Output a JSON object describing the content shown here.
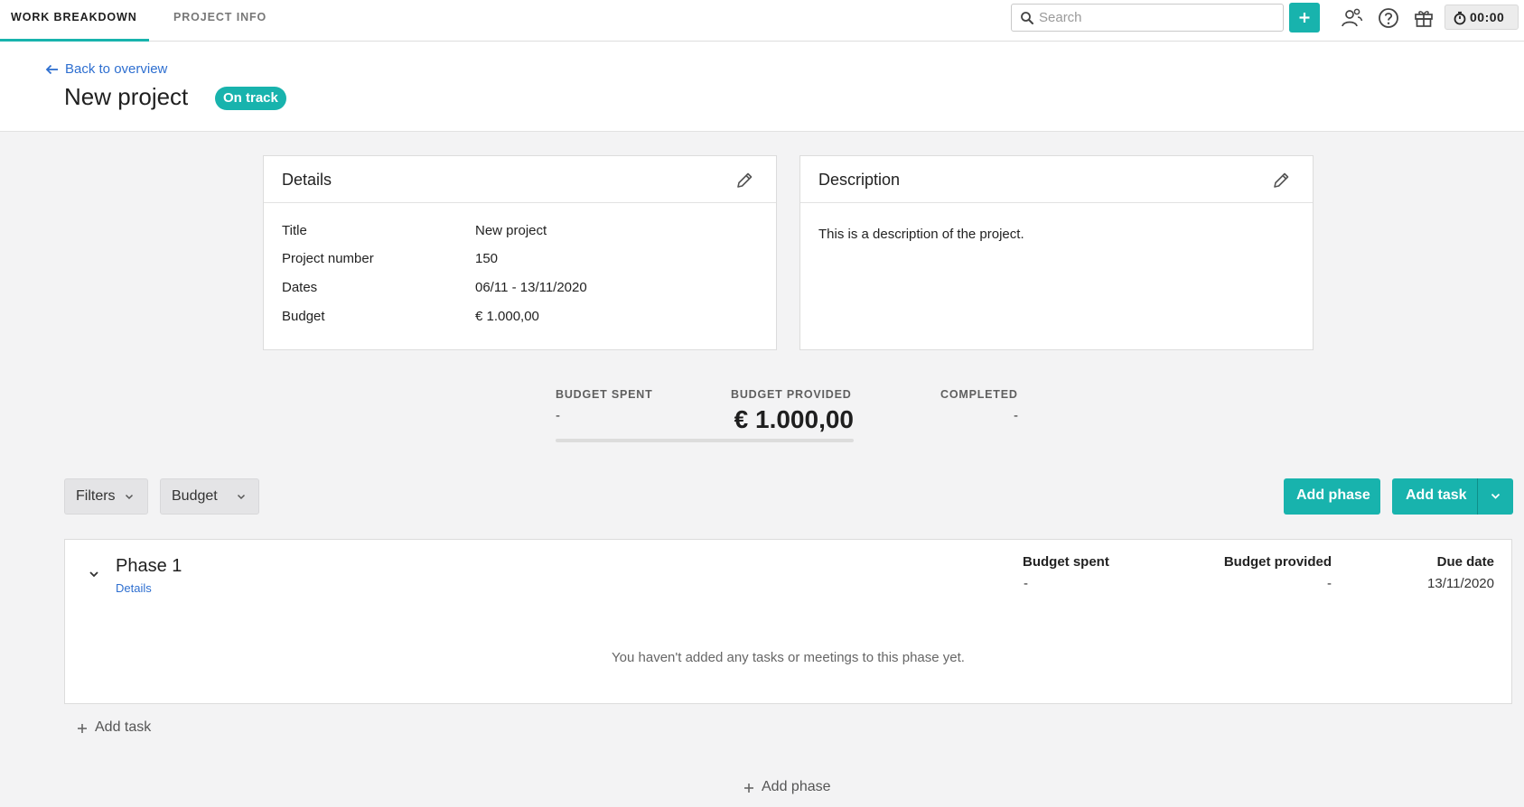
{
  "nav": {
    "tabs": [
      {
        "label": "WORK BREAKDOWN",
        "active": true
      },
      {
        "label": "PROJECT INFO",
        "active": false
      }
    ],
    "search": {
      "placeholder": "Search",
      "value": ""
    },
    "add_button_icon": "plus-icon",
    "icons": [
      "people-icon",
      "help-icon",
      "gift-icon"
    ],
    "timer": {
      "icon": "stopwatch-icon",
      "value": "00:00"
    }
  },
  "header": {
    "back_label": "Back to overview",
    "project_title": "New project",
    "status_badge": "On track",
    "status_color": "#18b3ad"
  },
  "details_card": {
    "title": "Details",
    "rows": [
      {
        "label": "Title",
        "value": "New project"
      },
      {
        "label": "Project number",
        "value": "150"
      },
      {
        "label": "Dates",
        "value": "06/11 - 13/11/2020"
      },
      {
        "label": "Budget",
        "value": "€ 1.000,00"
      }
    ]
  },
  "description_card": {
    "title": "Description",
    "text": "This is a description of the project."
  },
  "stats": {
    "budget_spent": {
      "label": "BUDGET SPENT",
      "value": "-"
    },
    "budget_provided": {
      "label": "BUDGET PROVIDED",
      "value": "€ 1.000,00"
    },
    "completed": {
      "label": "COMPLETED",
      "value": "-"
    }
  },
  "toolbar": {
    "filters_label": "Filters",
    "view_select": "Budget",
    "add_phase_label": "Add phase",
    "add_task_label": "Add task"
  },
  "phases": [
    {
      "name": "Phase 1",
      "details_link": "Details",
      "columns": [
        {
          "header": "Budget spent",
          "value": "-"
        },
        {
          "header": "Budget provided",
          "value": "-"
        },
        {
          "header": "Due date",
          "value": "13/11/2020"
        }
      ],
      "empty_message": "You haven't added any tasks or meetings to this phase yet.",
      "add_task_label": "Add task"
    }
  ],
  "add_phase_bottom_label": "Add phase",
  "colors": {
    "accent": "#18b3ad",
    "link": "#2e6fd0"
  }
}
